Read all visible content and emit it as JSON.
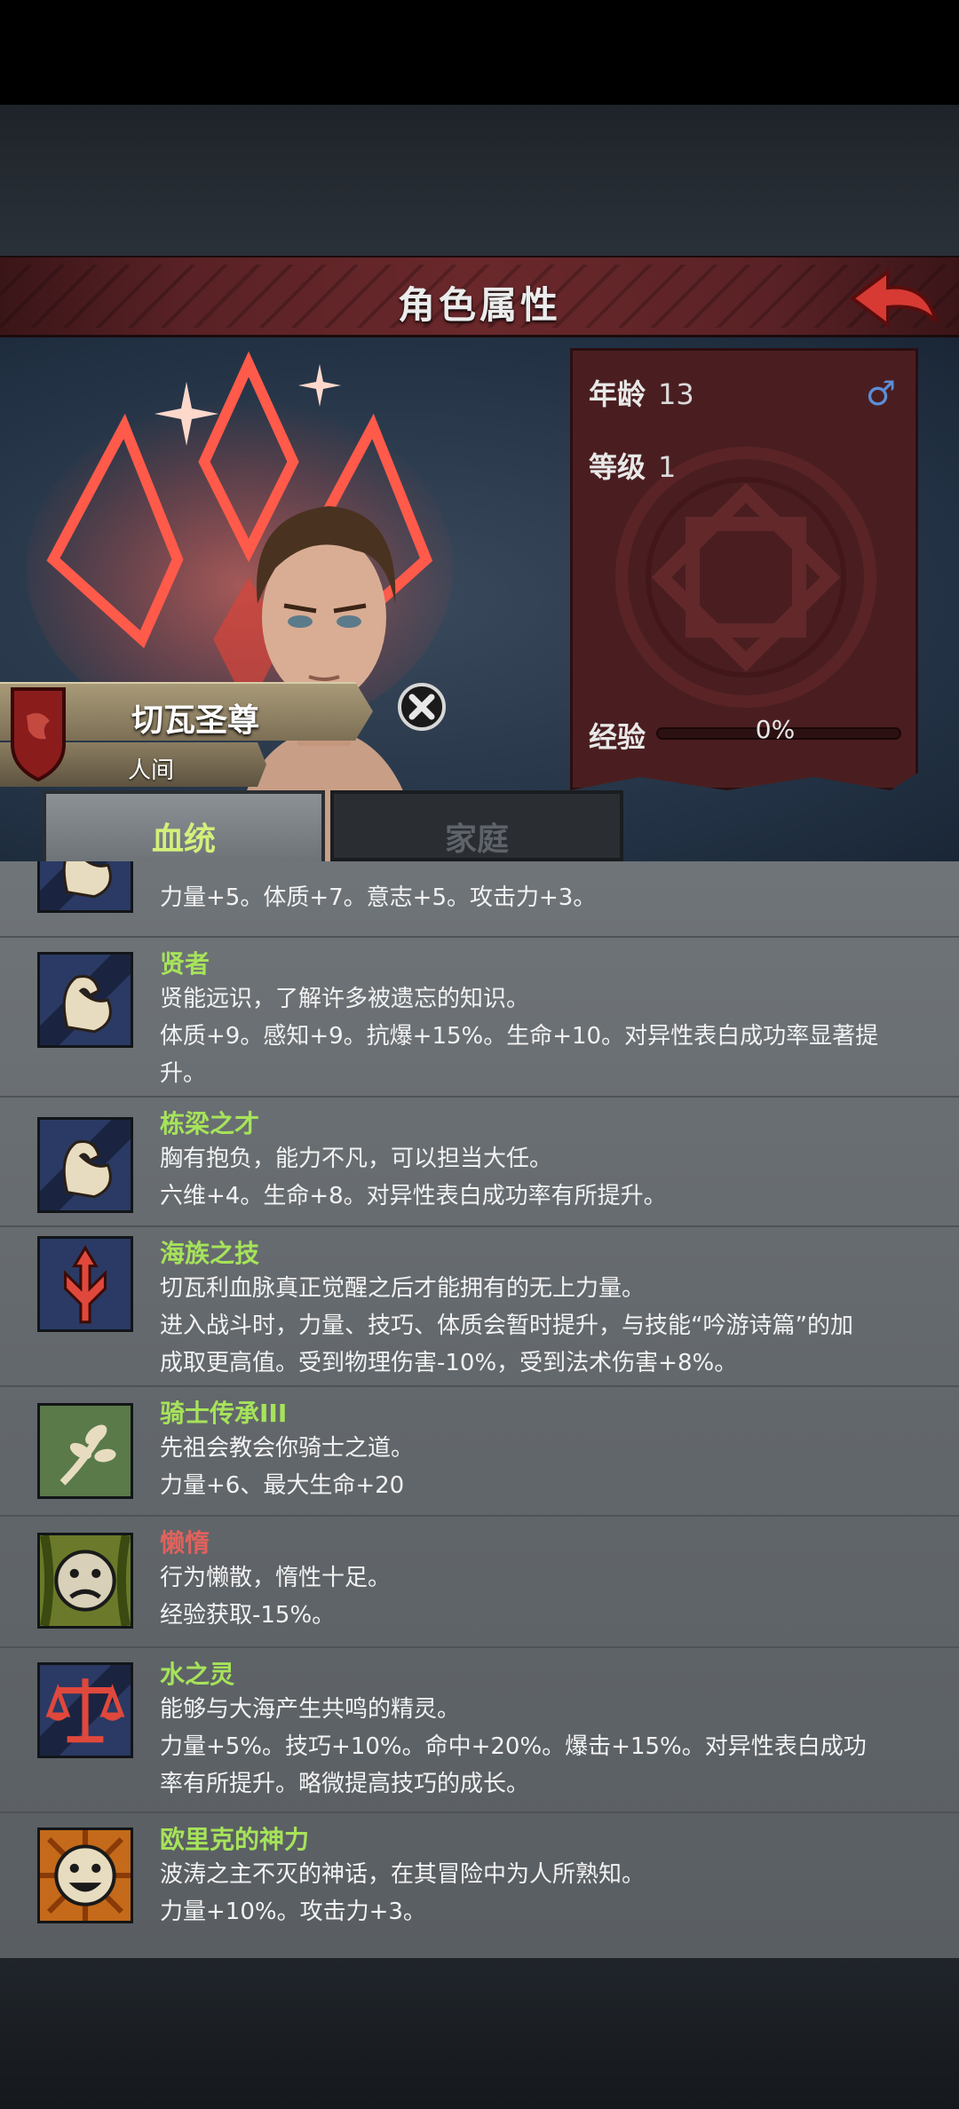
{
  "header": {
    "title": "角色属性"
  },
  "character": {
    "name": "切瓦圣尊",
    "realm": "人间"
  },
  "stats": {
    "age_label": "年龄",
    "age_value": "13",
    "level_label": "等级",
    "level_value": "1",
    "exp_label": "经验",
    "exp_value": "0%",
    "exp_fraction": 0,
    "gender_symbol": "♂"
  },
  "tabs": [
    {
      "label": "血统",
      "active": true
    },
    {
      "label": "家庭",
      "active": false
    }
  ],
  "traits": {
    "partial_line": "力量+5。体质+7。意志+5。攻击力+3。",
    "items": [
      {
        "name": "贤者",
        "color": "green",
        "icon": "strong-arm-icon",
        "lines": [
          "贤能远识，了解许多被遗忘的知识。",
          "体质+9。感知+9。抗爆+15%。生命+10。对异性表白成功率显著提",
          "升。"
        ]
      },
      {
        "name": "栋梁之才",
        "color": "green",
        "icon": "strong-arm-icon",
        "lines": [
          "胸有抱负，能力不凡，可以担当大任。",
          "六维+4。生命+8。对异性表白成功率有所提升。"
        ]
      },
      {
        "name": "海族之技",
        "color": "green",
        "icon": "trident-icon",
        "lines": [
          "切瓦利血脉真正觉醒之后才能拥有的无上力量。",
          "进入战斗时，力量、技巧、体质会暂时提升，与技能“吟游诗篇”的加",
          "成取更高值。受到物理伤害-10%，受到法术伤害+8%。"
        ]
      },
      {
        "name": "骑士传承III",
        "color": "green",
        "icon": "branch-icon",
        "lines": [
          "先祖会教会你骑士之道。",
          "力量+6、最大生命+20"
        ]
      },
      {
        "name": "懒惰",
        "color": "red",
        "icon": "sad-face-icon",
        "lines": [
          "行为懒散，惰性十足。",
          "经验获取-15%。"
        ]
      },
      {
        "name": "水之灵",
        "color": "green",
        "icon": "scales-icon",
        "lines": [
          "能够与大海产生共鸣的精灵。",
          "力量+5%。技巧+10%。命中+20%。爆击+15%。对异性表白成功",
          "率有所提升。略微提高技巧的成长。"
        ]
      },
      {
        "name": "欧里克的神力",
        "color": "green",
        "icon": "happy-face-icon",
        "lines": [
          "波涛之主不灭的神话，在其冒险中为人所熟知。",
          "力量+10%。攻击力+3。"
        ]
      }
    ]
  }
}
